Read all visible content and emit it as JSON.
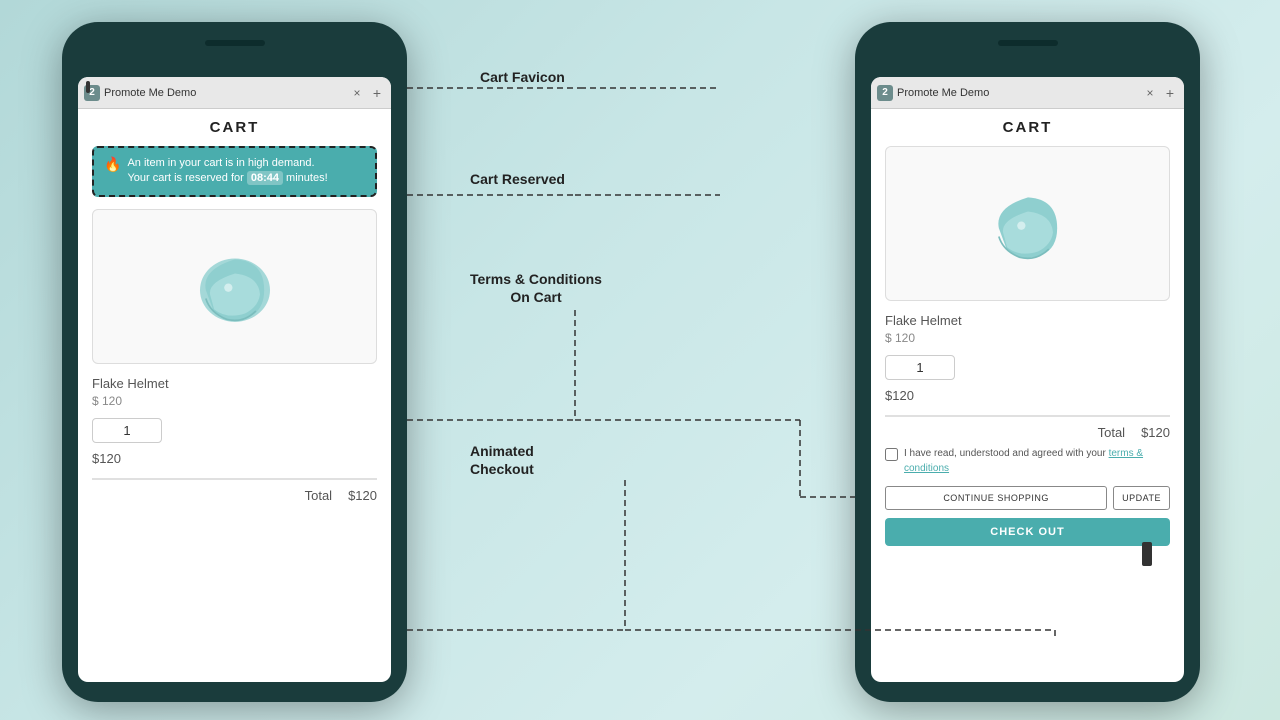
{
  "left_phone": {
    "tab": {
      "badge": "2",
      "title": "Promote Me Demo",
      "close": "×",
      "new": "+"
    },
    "cart": {
      "title": "CART",
      "notification": {
        "icon": "🔥",
        "line1": "An item in your cart is in high demand.",
        "line2_prefix": "Your cart is reserved for ",
        "timer": "08:44",
        "line2_suffix": " minutes!"
      },
      "product": {
        "name": "Flake Helmet",
        "price_display": "$ 120",
        "qty": "1",
        "subtotal": "$120"
      },
      "total_label": "Total",
      "total_value": "$120"
    }
  },
  "right_phone": {
    "tab": {
      "badge": "2",
      "title": "Promote Me Demo",
      "close": "×",
      "new": "+"
    },
    "cart": {
      "title": "CART",
      "product": {
        "name": "Flake Helmet",
        "price_display": "$ 120",
        "qty": "1",
        "subtotal": "$120"
      },
      "total_label": "Total",
      "total_value": "$120",
      "terms_text1": "I have read, understood and agreed with your ",
      "terms_link": "terms & conditions",
      "btn_continue": "CONTINUE SHOPPING",
      "btn_update": "UPDATE",
      "btn_checkout": "CHECK OUT"
    }
  },
  "annotations": {
    "cart_favicon": "Cart Favicon",
    "cart_reserved": "Cart Reserved",
    "terms_conditions": "Terms & Conditions\nOn Cart",
    "animated_checkout": "Animated\nCheckout"
  }
}
